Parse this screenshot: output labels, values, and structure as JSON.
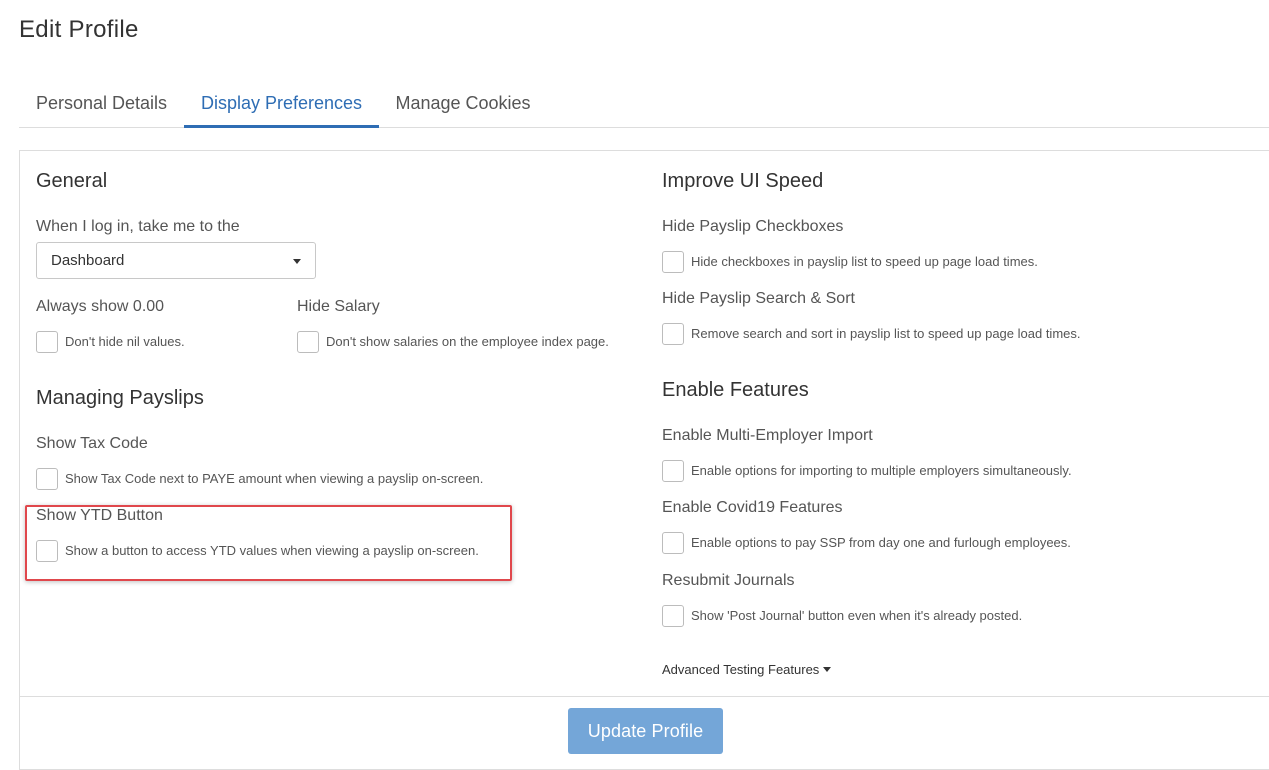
{
  "page": {
    "title": "Edit Profile"
  },
  "tabs": [
    {
      "label": "Personal Details"
    },
    {
      "label": "Display Preferences"
    },
    {
      "label": "Manage Cookies"
    }
  ],
  "active_tab": "Display Preferences",
  "colors": {
    "accent": "#2e6db4",
    "button": "#74a6d8",
    "highlight": "#e0474c"
  },
  "general": {
    "heading": "General",
    "login_label": "When I log in, take me to the",
    "login_select_value": "Dashboard",
    "always_show": {
      "label": "Always show 0.00",
      "checkbox_text": "Don't hide nil values.",
      "checked": false
    },
    "hide_salary": {
      "label": "Hide Salary",
      "checkbox_text": "Don't show salaries on the employee index page.",
      "checked": false
    }
  },
  "managing": {
    "heading": "Managing Payslips",
    "show_tax_code": {
      "label": "Show Tax Code",
      "checkbox_text": "Show Tax Code next to PAYE amount when viewing a payslip on-screen.",
      "checked": false
    },
    "show_ytd": {
      "label": "Show YTD Button",
      "checkbox_text": "Show a button to access YTD values when viewing a payslip on-screen.",
      "checked": false
    }
  },
  "improve": {
    "heading": "Improve UI Speed",
    "hide_checkboxes": {
      "label": "Hide Payslip Checkboxes",
      "checkbox_text": "Hide checkboxes in payslip list to speed up page load times.",
      "checked": false
    },
    "hide_search": {
      "label": "Hide Payslip Search & Sort",
      "checkbox_text": "Remove search and sort in payslip list to speed up page load times.",
      "checked": false
    }
  },
  "enable": {
    "heading": "Enable Features",
    "multi_employer": {
      "label": "Enable Multi-Employer Import",
      "checkbox_text": "Enable options for importing to multiple employers simultaneously.",
      "checked": false
    },
    "covid": {
      "label": "Enable Covid19 Features",
      "checkbox_text": "Enable options to pay SSP from day one and furlough employees.",
      "checked": false
    },
    "resubmit": {
      "label": "Resubmit Journals",
      "checkbox_text": "Show 'Post Journal' button even when it's already posted.",
      "checked": false
    }
  },
  "advanced": {
    "label": "Advanced Testing Features",
    "icon": "caret-down-icon"
  },
  "footer": {
    "update_label": "Update Profile"
  }
}
